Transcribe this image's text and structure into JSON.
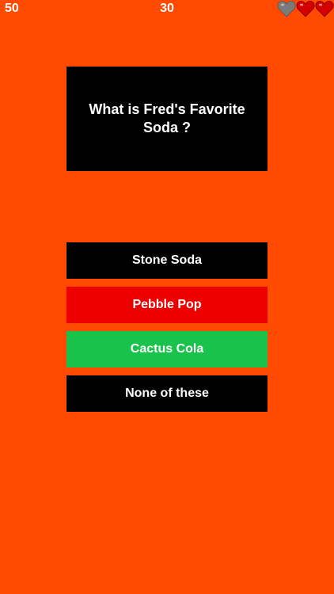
{
  "hud": {
    "score": "50",
    "timer": "30",
    "lives": [
      {
        "state": "lost",
        "color": "#7a7a7a",
        "icon": "heart-empty-icon"
      },
      {
        "state": "full",
        "color": "#d40000",
        "icon": "heart-icon"
      },
      {
        "state": "full",
        "color": "#d40000",
        "icon": "heart-icon"
      }
    ]
  },
  "question": {
    "text": "What is Fred's Favorite Soda ?"
  },
  "answers": [
    {
      "label": "Stone Soda",
      "color": "#000000"
    },
    {
      "label": "Pebble Pop",
      "color": "#EE0000"
    },
    {
      "label": "Cactus Cola",
      "color": "#19C24A"
    },
    {
      "label": "None of these",
      "color": "#000000"
    }
  ],
  "colors": {
    "background": "#FF4A00",
    "text": "#FFFFFF"
  }
}
